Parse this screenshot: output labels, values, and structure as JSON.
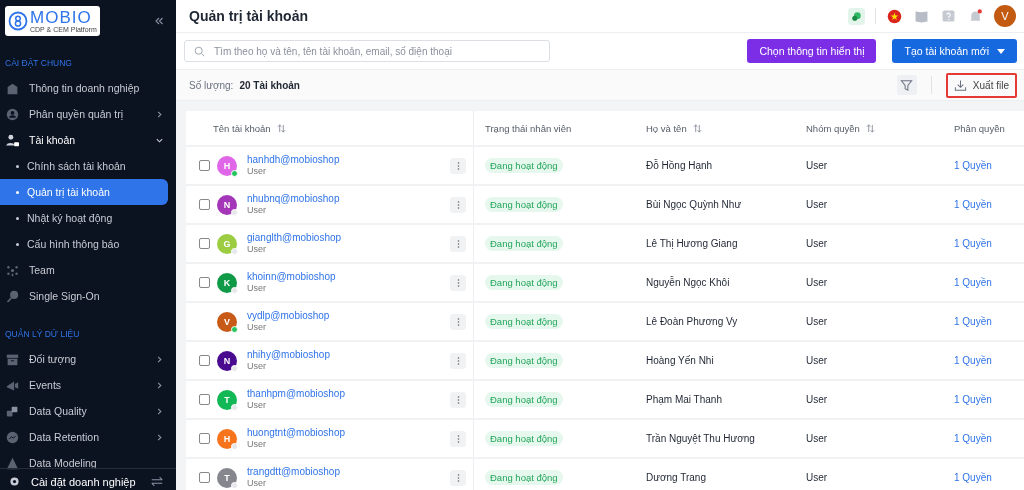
{
  "sidebar": {
    "logo": {
      "text": "MOBIO",
      "tagline": "CDP & CEM Platform"
    },
    "sections": [
      {
        "title": "CÀI ĐẶT CHUNG",
        "items": [
          {
            "label": "Thông tin doanh nghiệp",
            "collapsible": false,
            "selected": false,
            "expanded": false
          },
          {
            "label": "Phân quyền quản trị",
            "collapsible": true,
            "selected": false,
            "expanded": false
          },
          {
            "label": "Tài khoản",
            "collapsible": true,
            "selected": false,
            "expanded": true,
            "children": [
              {
                "label": "Chính sách tài khoản",
                "selected": false
              },
              {
                "label": "Quản trị tài khoản",
                "selected": true
              },
              {
                "label": "Nhật ký hoạt động",
                "selected": false
              },
              {
                "label": "Cấu hình thông báo",
                "selected": false
              }
            ]
          },
          {
            "label": "Team",
            "collapsible": false,
            "selected": false,
            "expanded": false
          },
          {
            "label": "Single Sign-On",
            "collapsible": false,
            "selected": false,
            "expanded": false
          }
        ]
      },
      {
        "title": "QUẢN LÝ DỮ LIỆU",
        "items": [
          {
            "label": "Đối tượng",
            "collapsible": true,
            "selected": false,
            "expanded": false
          },
          {
            "label": "Events",
            "collapsible": true,
            "selected": false,
            "expanded": false
          },
          {
            "label": "Data Quality",
            "collapsible": true,
            "selected": false,
            "expanded": false
          },
          {
            "label": "Data Retention",
            "collapsible": true,
            "selected": false,
            "expanded": false
          },
          {
            "label": "Data Modeling",
            "collapsible": false,
            "selected": false,
            "expanded": false
          }
        ]
      }
    ],
    "footer": "Cài đặt doanh nghiệp"
  },
  "header": {
    "title": "Quản trị tài khoản",
    "avatar": "V"
  },
  "toolbar": {
    "search": {
      "placeholder": "Tìm theo họ và tên, tên tài khoản, email, số điện thoại"
    },
    "display_button": "Chọn thông tin hiển thị",
    "create_button": "Tạo tài khoản mới"
  },
  "summary": {
    "label": "Số lượng:",
    "count": "20 Tài khoản",
    "export_button": "Xuất file",
    "export_highlighted": true
  },
  "table": {
    "columns": [
      {
        "label": "Tên tài khoản",
        "sortable": true
      },
      {
        "label": "Trạng thái nhân viên",
        "sortable": false
      },
      {
        "label": "Họ và tên",
        "sortable": true
      },
      {
        "label": "Nhóm quyền",
        "sortable": true
      },
      {
        "label": "Phân quyền",
        "sortable": false
      }
    ],
    "rows": [
      {
        "initial": "H",
        "color": "#e066e8",
        "online": true,
        "selectable": true,
        "account": "hanhdh@mobioshop",
        "role": "User",
        "status": "Đang hoạt động",
        "name": "Đỗ Hồng Hạnh",
        "group": "User",
        "permission": "1 Quyền"
      },
      {
        "initial": "N",
        "color": "#a437b8",
        "online": false,
        "selectable": true,
        "account": "nhubnq@mobioshop",
        "role": "User",
        "status": "Đang hoạt động",
        "name": "Bùi Ngọc Quỳnh Như",
        "group": "User",
        "permission": "1 Quyền"
      },
      {
        "initial": "G",
        "color": "#9ccc42",
        "online": false,
        "selectable": true,
        "account": "gianglth@mobioshop",
        "role": "User",
        "status": "Đang hoạt động",
        "name": "Lê Thị Hương Giang",
        "group": "User",
        "permission": "1 Quyền"
      },
      {
        "initial": "K",
        "color": "#109a48",
        "online": false,
        "selectable": true,
        "account": "khoinn@mobioshop",
        "role": "User",
        "status": "Đang hoạt động",
        "name": "Nguyễn Ngọc Khôi",
        "group": "User",
        "permission": "1 Quyền"
      },
      {
        "initial": "V",
        "color": "#c75a16",
        "online": true,
        "selectable": false,
        "account": "vydlp@mobioshop",
        "role": "User",
        "status": "Đang hoạt động",
        "name": "Lê Đoàn Phương Vy",
        "group": "User",
        "permission": "1 Quyền"
      },
      {
        "initial": "N",
        "color": "#4a0a8f",
        "online": false,
        "selectable": true,
        "account": "nhihy@mobioshop",
        "role": "User",
        "status": "Đang hoạt động",
        "name": "Hoàng Yến Nhi",
        "group": "User",
        "permission": "1 Quyền"
      },
      {
        "initial": "T",
        "color": "#12b856",
        "online": false,
        "selectable": true,
        "account": "thanhpm@mobioshop",
        "role": "User",
        "status": "Đang hoạt động",
        "name": "Phạm Mai Thanh",
        "group": "User",
        "permission": "1 Quyền"
      },
      {
        "initial": "H",
        "color": "#f7731c",
        "online": false,
        "selectable": true,
        "account": "huongtnt@mobioshop",
        "role": "User",
        "status": "Đang hoạt động",
        "name": "Trần Nguyệt Thu Hương",
        "group": "User",
        "permission": "1 Quyền"
      },
      {
        "initial": "T",
        "color": "#86868e",
        "online": false,
        "selectable": true,
        "account": "trangdtt@mobioshop",
        "role": "User",
        "status": "Đang hoạt động",
        "name": "Dương Trang",
        "group": "User",
        "permission": "1 Quyền"
      }
    ]
  }
}
